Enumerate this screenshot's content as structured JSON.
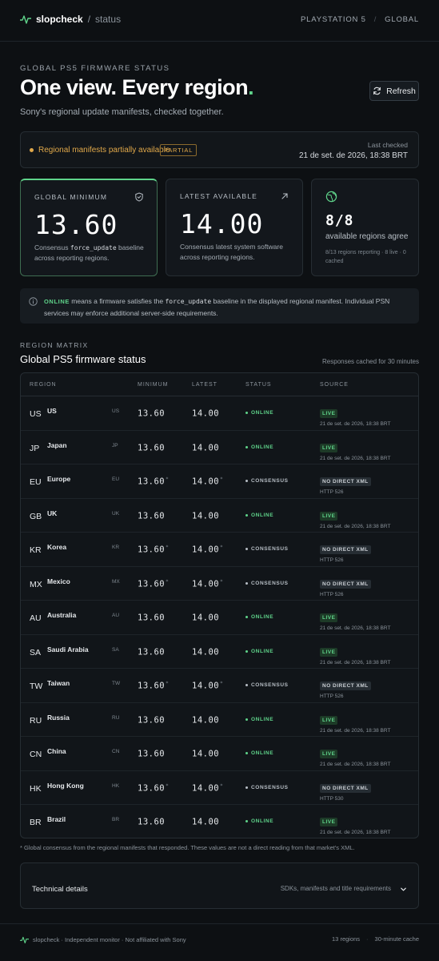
{
  "header": {
    "brand": "slopcheck",
    "brand_sep": "/",
    "brand_sub": "status",
    "crumb_1": "PLAYSTATION 5",
    "crumb_sep": "/",
    "crumb_2": "GLOBAL"
  },
  "hero": {
    "eyebrow": "GLOBAL PS5 FIRMWARE STATUS",
    "title": "One view. Every region",
    "title_dot": ".",
    "subtitle": "Sony's regional update manifests, checked together.",
    "refresh_label": "Refresh"
  },
  "banner": {
    "message": "Regional manifests partially available",
    "badge": "PARTIAL",
    "last_checked_label": "Last checked",
    "last_checked_value": "21 de set. de 2026, 18:38 BRT"
  },
  "cards": {
    "min": {
      "title": "GLOBAL MINIMUM",
      "value": "13.60",
      "desc_pre": "Consensus ",
      "desc_code": "force_update",
      "desc_post": " baseline across reporting regions."
    },
    "latest": {
      "title": "LATEST AVAILABLE",
      "value": "14.00",
      "desc": "Consensus latest system software across reporting regions."
    },
    "agree": {
      "value": "8/8",
      "label": "available regions agree",
      "detail": "8/13 regions reporting · 8 live · 0 cached"
    }
  },
  "note": {
    "keyword": "ONLINE",
    "text_pre": " means a firmware satisfies the ",
    "code": "force_update",
    "text_post": " baseline in the displayed regional manifest. Individual PSN services may enforce additional server-side requirements."
  },
  "matrix": {
    "eyebrow": "REGION MATRIX",
    "title": "Global PS5 firmware status",
    "cache_note": "Responses cached for 30 minutes",
    "columns": [
      "REGION",
      "MINIMUM",
      "LATEST",
      "STATUS",
      "SOURCE"
    ],
    "rows": [
      {
        "code": "US",
        "name": "US",
        "abbr": "US",
        "min": "13.60",
        "latest": "14.00",
        "mark": "",
        "status": "ONLINE",
        "kind": "online",
        "tag": "LIVE",
        "src": "21 de set. de 2026, 18:38 BRT"
      },
      {
        "code": "JP",
        "name": "Japan",
        "abbr": "JP",
        "min": "13.60",
        "latest": "14.00",
        "mark": "",
        "status": "ONLINE",
        "kind": "online",
        "tag": "LIVE",
        "src": "21 de set. de 2026, 18:38 BRT"
      },
      {
        "code": "EU",
        "name": "Europe",
        "abbr": "EU",
        "min": "13.60",
        "latest": "14.00",
        "mark": "*",
        "status": "CONSENSUS",
        "kind": "consensus",
        "tag": "NO DIRECT XML",
        "src": "HTTP 526"
      },
      {
        "code": "GB",
        "name": "UK",
        "abbr": "UK",
        "min": "13.60",
        "latest": "14.00",
        "mark": "",
        "status": "ONLINE",
        "kind": "online",
        "tag": "LIVE",
        "src": "21 de set. de 2026, 18:38 BRT"
      },
      {
        "code": "KR",
        "name": "Korea",
        "abbr": "KR",
        "min": "13.60",
        "latest": "14.00",
        "mark": "*",
        "status": "CONSENSUS",
        "kind": "consensus",
        "tag": "NO DIRECT XML",
        "src": "HTTP 526"
      },
      {
        "code": "MX",
        "name": "Mexico",
        "abbr": "MX",
        "min": "13.60",
        "latest": "14.00",
        "mark": "*",
        "status": "CONSENSUS",
        "kind": "consensus",
        "tag": "NO DIRECT XML",
        "src": "HTTP 526"
      },
      {
        "code": "AU",
        "name": "Australia",
        "abbr": "AU",
        "min": "13.60",
        "latest": "14.00",
        "mark": "",
        "status": "ONLINE",
        "kind": "online",
        "tag": "LIVE",
        "src": "21 de set. de 2026, 18:38 BRT"
      },
      {
        "code": "SA",
        "name": "Saudi Arabia",
        "abbr": "SA",
        "min": "13.60",
        "latest": "14.00",
        "mark": "",
        "status": "ONLINE",
        "kind": "online",
        "tag": "LIVE",
        "src": "21 de set. de 2026, 18:38 BRT"
      },
      {
        "code": "TW",
        "name": "Taiwan",
        "abbr": "TW",
        "min": "13.60",
        "latest": "14.00",
        "mark": "*",
        "status": "CONSENSUS",
        "kind": "consensus",
        "tag": "NO DIRECT XML",
        "src": "HTTP 526"
      },
      {
        "code": "RU",
        "name": "Russia",
        "abbr": "RU",
        "min": "13.60",
        "latest": "14.00",
        "mark": "",
        "status": "ONLINE",
        "kind": "online",
        "tag": "LIVE",
        "src": "21 de set. de 2026, 18:38 BRT"
      },
      {
        "code": "CN",
        "name": "China",
        "abbr": "CN",
        "min": "13.60",
        "latest": "14.00",
        "mark": "",
        "status": "ONLINE",
        "kind": "online",
        "tag": "LIVE",
        "src": "21 de set. de 2026, 18:38 BRT"
      },
      {
        "code": "HK",
        "name": "Hong Kong",
        "abbr": "HK",
        "min": "13.60",
        "latest": "14.00",
        "mark": "*",
        "status": "CONSENSUS",
        "kind": "consensus",
        "tag": "NO DIRECT XML",
        "src": "HTTP 530"
      },
      {
        "code": "BR",
        "name": "Brazil",
        "abbr": "BR",
        "min": "13.60",
        "latest": "14.00",
        "mark": "",
        "status": "ONLINE",
        "kind": "online",
        "tag": "LIVE",
        "src": "21 de set. de 2026, 18:38 BRT"
      }
    ],
    "footnote": "* Global consensus from the regional manifests that responded. These values are not a direct reading from that market's XML."
  },
  "technical": {
    "label": "Technical details",
    "summary": "SDKs, manifests and title requirements"
  },
  "footer": {
    "left": "slopcheck · Independent monitor · Not affiliated with Sony",
    "regions": "13 regions",
    "sep": "·",
    "cache": "30-minute cache"
  },
  "colors": {
    "accent": "#5fd38a",
    "warning": "#e0a84a",
    "background": "#0d1013"
  },
  "icons": {
    "brand": "pulse-icon",
    "refresh": "refresh-icon",
    "min_card": "shield-icon",
    "latest_card": "arrow-up-right-icon",
    "agree_card": "globe-icon",
    "note": "info-icon",
    "technical": "chevron-down-icon"
  }
}
